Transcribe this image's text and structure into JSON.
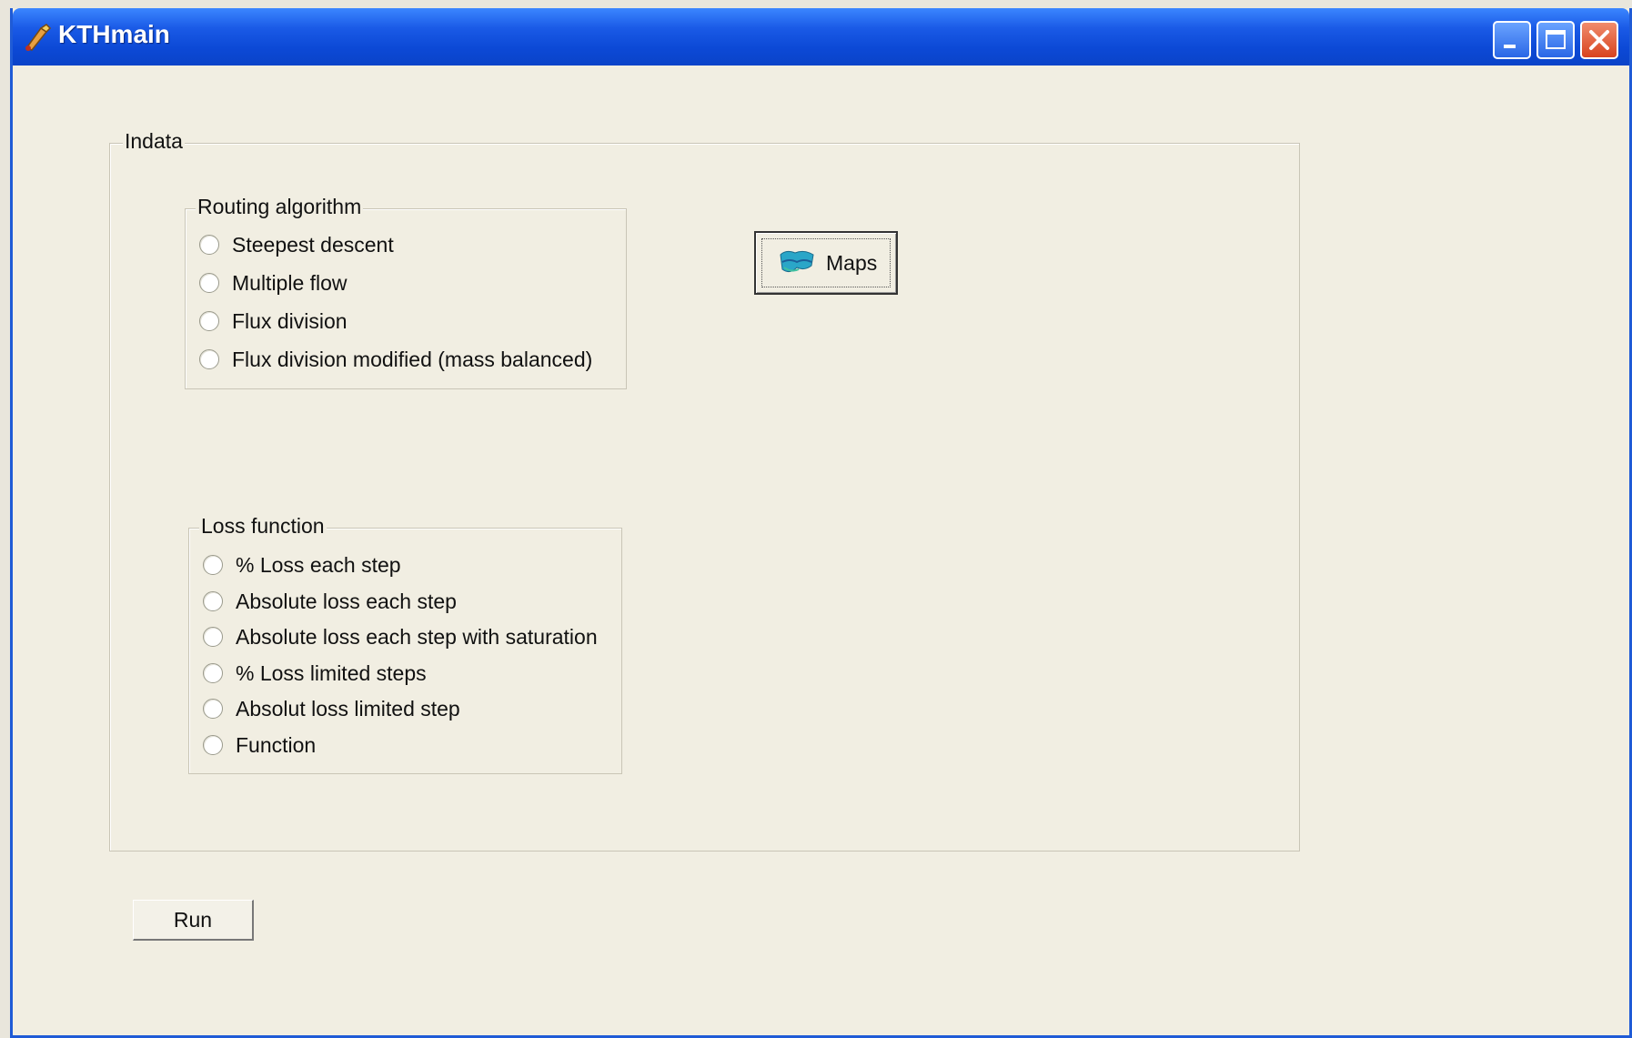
{
  "window": {
    "title": "KTHmain"
  },
  "indata": {
    "legend": "Indata"
  },
  "routing": {
    "legend": "Routing algorithm",
    "options": [
      "Steepest descent",
      "Multiple flow",
      "Flux division",
      "Flux division modified (mass balanced)"
    ]
  },
  "loss": {
    "legend": "Loss function",
    "options": [
      "% Loss each step",
      "Absolute loss each step",
      "Absolute loss each step with saturation",
      "% Loss limited steps",
      "Absolut loss limited step",
      "Function"
    ]
  },
  "buttons": {
    "maps_label": "Maps",
    "maps_icon": "map-icon",
    "run_label": "Run"
  },
  "colors": {
    "titlebar": "#0c49d6",
    "face": "#f1eee2",
    "close": "#d8431f"
  }
}
